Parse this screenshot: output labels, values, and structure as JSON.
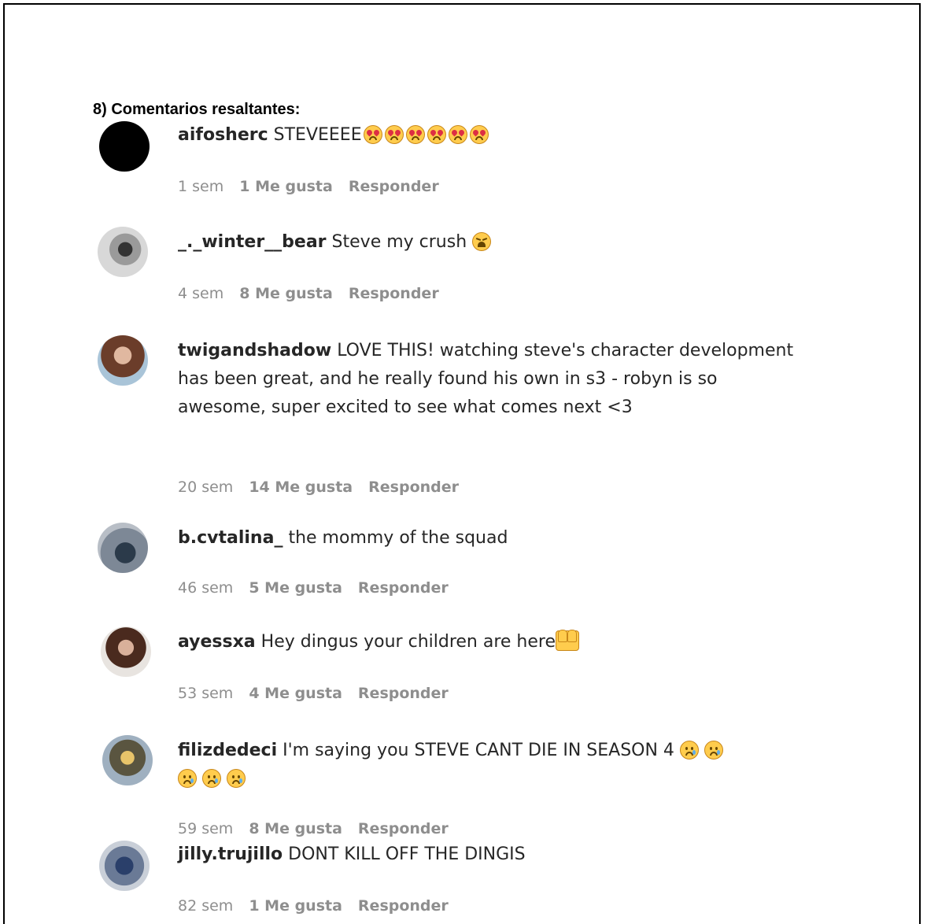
{
  "section_title": "8) Comentarios resaltantes:",
  "comments": [
    {
      "username": "aifosherc",
      "text": "STEVEEEE",
      "emojis": [
        "heart-eyes-icon",
        "heart-eyes-icon",
        "heart-eyes-icon",
        "heart-eyes-icon",
        "heart-eyes-icon",
        "heart-eyes-icon"
      ],
      "time": "1 sem",
      "likes": "1 Me gusta",
      "reply": "Responder"
    },
    {
      "username": "_._winter__bear",
      "text": "Steve my crush",
      "emojis": [
        "weary-face-icon"
      ],
      "time": "4 sem",
      "likes": "8 Me gusta",
      "reply": "Responder"
    },
    {
      "username": "twigandshadow",
      "text": "LOVE THIS! watching steve's character development has been great, and he really found his own in s3 - robyn is so awesome, super excited to see what comes next <3",
      "emojis": [],
      "time": "20 sem",
      "likes": "14 Me gusta",
      "reply": "Responder"
    },
    {
      "username": "b.cvtalina_",
      "text": "the mommy of the squad",
      "emojis": [],
      "time": "46 sem",
      "likes": "5 Me gusta",
      "reply": "Responder"
    },
    {
      "username": "ayessxa",
      "text": "Hey dingus your children are here",
      "emojis": [
        "raised-hands-icon"
      ],
      "time": "53 sem",
      "likes": "4 Me gusta",
      "reply": "Responder"
    },
    {
      "username": "filizdedeci",
      "text": "I'm saying you STEVE CANT DIE IN SEASON 4",
      "emojis": [
        "crying-face-icon",
        "crying-face-icon",
        "crying-face-icon",
        "crying-face-icon",
        "crying-face-icon"
      ],
      "time": "59 sem",
      "likes": "8 Me gusta",
      "reply": "Responder"
    },
    {
      "username": "jilly.trujillo",
      "text": "DONT KILL OFF THE DINGIS",
      "emojis": [],
      "time": "82 sem",
      "likes": "1 Me gusta",
      "reply": "Responder"
    }
  ]
}
